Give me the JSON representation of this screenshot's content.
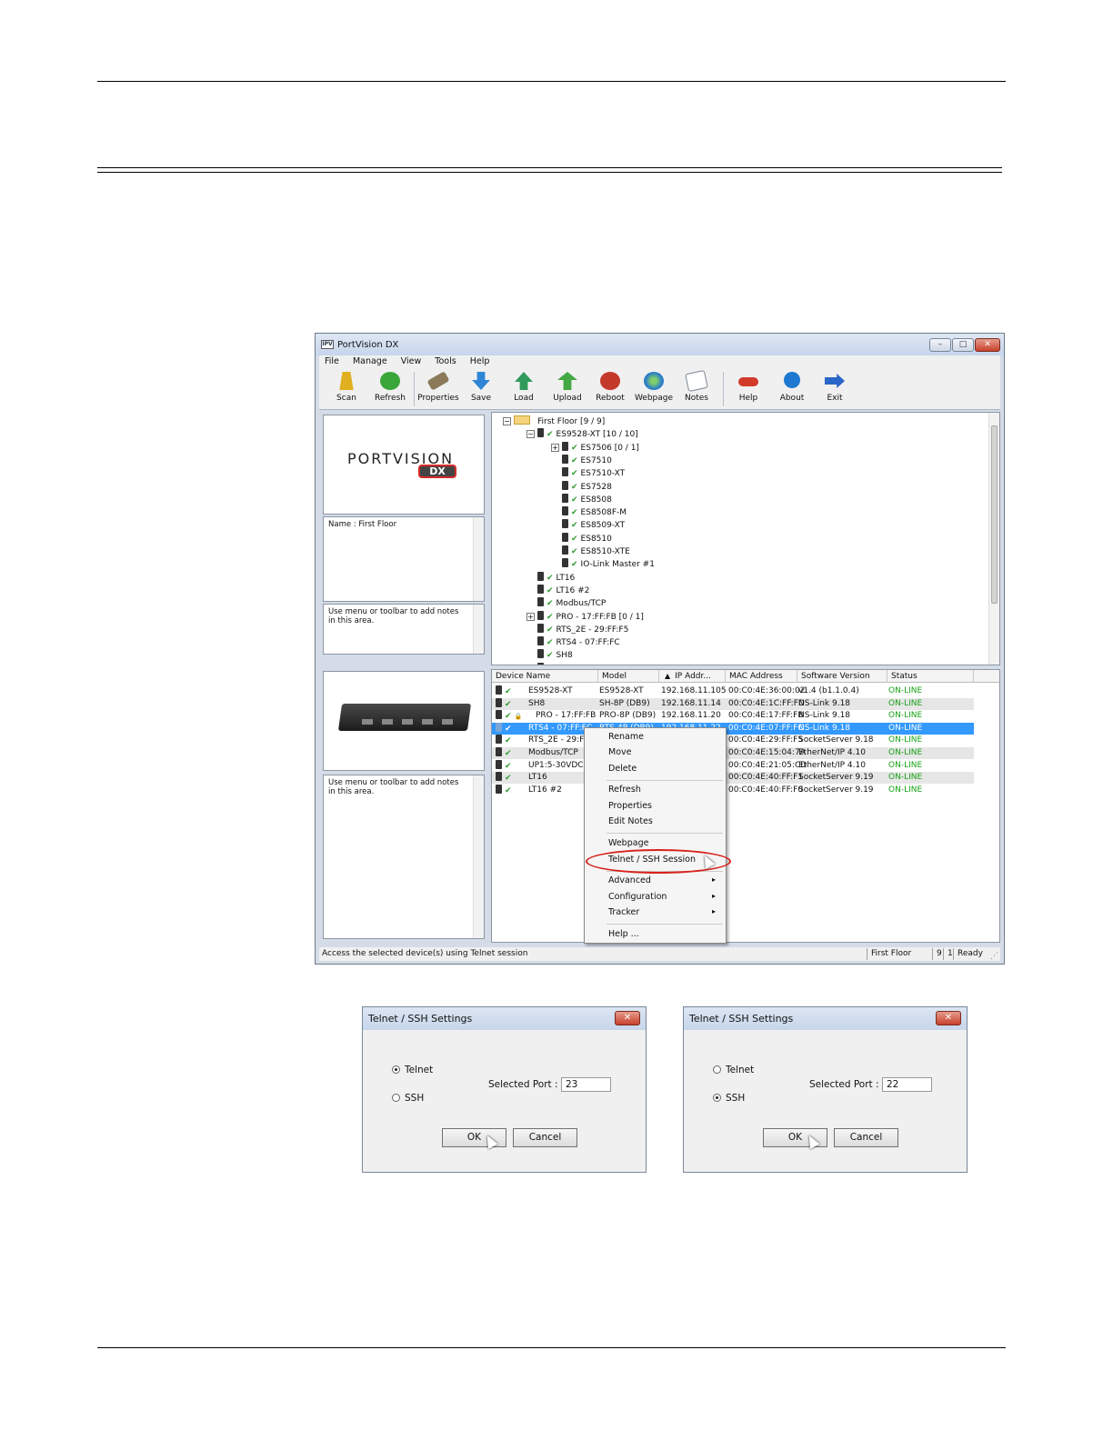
{
  "window": {
    "app_icon": "IPV",
    "title": "PortVision DX",
    "controls": [
      "minimize-icon",
      "maximize-icon",
      "close-icon"
    ]
  },
  "menu": [
    "File",
    "Manage",
    "View",
    "Tools",
    "Help"
  ],
  "toolbar": [
    {
      "label": "Scan",
      "icon": "scan-icon",
      "color": "#e0b020"
    },
    {
      "label": "Refresh",
      "icon": "refresh-icon",
      "color": "#3aa63a"
    },
    {
      "label": "Properties",
      "icon": "properties-icon",
      "color": "#8a7a5a"
    },
    {
      "label": "Save",
      "icon": "save-icon",
      "color": "#2f86d6"
    },
    {
      "label": "Load",
      "icon": "load-icon",
      "color": "#2f9b5a"
    },
    {
      "label": "Upload",
      "icon": "upload-icon",
      "color": "#44a844"
    },
    {
      "label": "Reboot",
      "icon": "reboot-icon",
      "color": "#c43a2a"
    },
    {
      "label": "Webpage",
      "icon": "webpage-icon",
      "color": "#2d7fc8"
    },
    {
      "label": "Notes",
      "icon": "notes-icon",
      "color": "#9aa6b4"
    },
    {
      "label": "Help",
      "icon": "help-icon",
      "color": "#d23a2a"
    },
    {
      "label": "About",
      "icon": "about-icon",
      "color": "#1e78d2"
    },
    {
      "label": "Exit",
      "icon": "exit-icon",
      "color": "#2a66c8"
    }
  ],
  "logo": {
    "main": "PORTVISION",
    "sub": "DX"
  },
  "name_panel": "Name : First Floor",
  "notes_hint": "Use menu or toolbar to add notes in this area.",
  "notes_hint2": "Use menu or toolbar to add notes in this area.",
  "tree": [
    {
      "label": "First Floor [9 / 9]",
      "level": 0,
      "kind": "folder",
      "expander": "−"
    },
    {
      "label": "ES9528-XT [10 / 10]",
      "level": 1,
      "kind": "device",
      "expander": "−"
    },
    {
      "label": "ES7506 [0 / 1]",
      "level": 2,
      "kind": "device",
      "expander": "+"
    },
    {
      "label": "ES7510",
      "level": 2,
      "kind": "device"
    },
    {
      "label": "ES7510-XT",
      "level": 2,
      "kind": "device"
    },
    {
      "label": "ES7528",
      "level": 2,
      "kind": "device"
    },
    {
      "label": "ES8508",
      "level": 2,
      "kind": "device"
    },
    {
      "label": "ES8508F-M",
      "level": 2,
      "kind": "device"
    },
    {
      "label": "ES8509-XT",
      "level": 2,
      "kind": "device"
    },
    {
      "label": "ES8510",
      "level": 2,
      "kind": "device"
    },
    {
      "label": "ES8510-XTE",
      "level": 2,
      "kind": "device"
    },
    {
      "label": "IO-Link Master #1",
      "level": 2,
      "kind": "device"
    },
    {
      "label": "LT16",
      "level": 1,
      "kind": "device"
    },
    {
      "label": "LT16 #2",
      "level": 1,
      "kind": "device"
    },
    {
      "label": "Modbus/TCP",
      "level": 1,
      "kind": "device"
    },
    {
      "label": "PRO - 17:FF:FB [0 / 1]",
      "level": 1,
      "kind": "device",
      "expander": "+"
    },
    {
      "label": "RTS_2E - 29:FF:F5",
      "level": 1,
      "kind": "device"
    },
    {
      "label": "RTS4 - 07:FF:FC",
      "level": 1,
      "kind": "device"
    },
    {
      "label": "SH8",
      "level": 1,
      "kind": "device"
    },
    {
      "label": "UP1:5-30VDC",
      "level": 1,
      "kind": "device"
    }
  ],
  "table": {
    "columns": [
      "Device Name",
      "Model",
      "IP Addr...",
      "MAC Address",
      "Software Version",
      "Status"
    ],
    "sort_indicator": "▲",
    "rows": [
      [
        "ES9528-XT",
        "ES9528-XT",
        "192.168.11.105",
        "00:C0:4E:36:00:02",
        "v1.4  (b1.1.0.4)",
        "ON-LINE"
      ],
      [
        "SH8",
        "SH-8P (DB9)",
        "192.168.11.14",
        "00:C0:4E:1C:FF:FD",
        "NS-Link 9.18",
        "ON-LINE"
      ],
      [
        "PRO - 17:FF:FB",
        "PRO-8P (DB9)",
        "192.168.11.20",
        "00:C0:4E:17:FF:FB",
        "NS-Link 9.18",
        "ON-LINE"
      ],
      [
        "RTS4 - 07:FF:FC",
        "RTS-4P (DB9)",
        "192.168.11.22",
        "00:C0:4E:07:FF:FC",
        "NS-Link 9.18",
        "ON-LINE"
      ],
      [
        "RTS_2E - 29:FF:F5",
        "",
        "",
        "00:C0:4E:29:FF:F5",
        "SocketServer 9.18",
        "ON-LINE"
      ],
      [
        "Modbus/TCP",
        "",
        "",
        "00:C0:4E:15:04:7A",
        "EtherNet/IP 4.10",
        "ON-LINE"
      ],
      [
        "UP1:5-30VDC",
        "",
        "",
        "00:C0:4E:21:05:CD",
        "EtherNet/IP 4.10",
        "ON-LINE"
      ],
      [
        "LT16",
        "",
        "",
        "00:C0:4E:40:FF:F1",
        "SocketServer 9.19",
        "ON-LINE"
      ],
      [
        "LT16 #2",
        "",
        "",
        "00:C0:4E:40:FF:F0",
        "SocketServer 9.19",
        "ON-LINE"
      ]
    ]
  },
  "context_menu": [
    {
      "label": "Rename"
    },
    {
      "label": "Move"
    },
    {
      "label": "Delete"
    },
    {
      "label": "Refresh"
    },
    {
      "label": "Properties"
    },
    {
      "label": "Edit Notes"
    },
    {
      "label": "Webpage"
    },
    {
      "label": "Telnet / SSH Session"
    },
    {
      "label": "Advanced",
      "submenu": true
    },
    {
      "label": "Configuration",
      "submenu": true
    },
    {
      "label": "Tracker",
      "submenu": true
    },
    {
      "label": "Help ..."
    }
  ],
  "statusbar": {
    "message": "Access the selected device(s) using Telnet session",
    "group": "First Floor",
    "count1": "9",
    "count2": "1",
    "state": "Ready"
  },
  "dialogs": [
    {
      "title": "Telnet / SSH Settings",
      "telnet": "Telnet",
      "ssh": "SSH",
      "selected": "telnet",
      "port_label": "Selected Port :",
      "port_value": "23",
      "ok": "OK",
      "cancel": "Cancel"
    },
    {
      "title": "Telnet / SSH Settings",
      "telnet": "Telnet",
      "ssh": "SSH",
      "selected": "ssh",
      "port_label": "Selected Port :",
      "port_value": "22",
      "ok": "OK",
      "cancel": "Cancel"
    }
  ],
  "colors": {
    "status_online": "#17a317",
    "selection": "#3399ff",
    "highlight_ring": "#d8231c"
  }
}
